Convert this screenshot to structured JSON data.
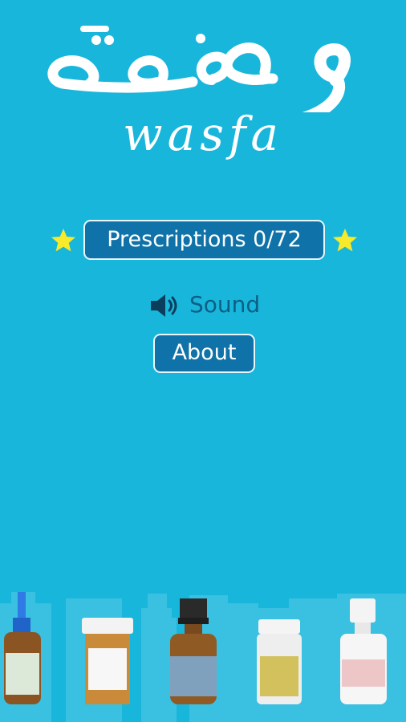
{
  "app": {
    "logo_text_arabic": "وصفة",
    "logo_text_latin": "wasfa"
  },
  "menu": {
    "prescriptions_label": "Prescriptions 0/72",
    "prescriptions_completed": 0,
    "prescriptions_total": 72,
    "sound_label": "Sound",
    "about_label": "About"
  },
  "icons": {
    "stars": "star-icon",
    "sound": "speaker-icon"
  },
  "colors": {
    "background": "#19b6dc",
    "button_fill": "#0f72a8",
    "button_border": "#e9f6fb",
    "star": "#f7ea2b",
    "sound_text": "#0b5f86"
  }
}
